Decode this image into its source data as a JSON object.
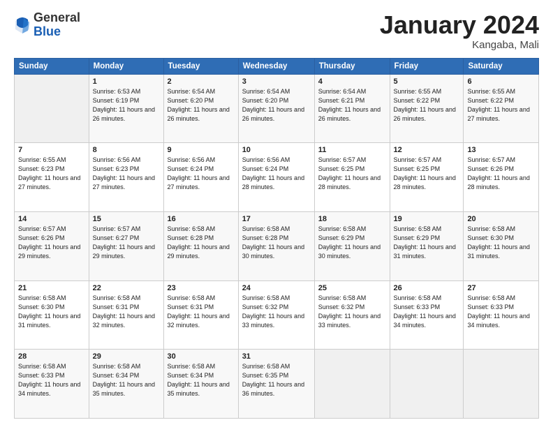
{
  "header": {
    "logo_general": "General",
    "logo_blue": "Blue",
    "month_title": "January 2024",
    "location": "Kangaba, Mali"
  },
  "days_of_week": [
    "Sunday",
    "Monday",
    "Tuesday",
    "Wednesday",
    "Thursday",
    "Friday",
    "Saturday"
  ],
  "weeks": [
    [
      {
        "day": "",
        "sunrise": "",
        "sunset": "",
        "daylight": ""
      },
      {
        "day": "1",
        "sunrise": "Sunrise: 6:53 AM",
        "sunset": "Sunset: 6:19 PM",
        "daylight": "Daylight: 11 hours and 26 minutes."
      },
      {
        "day": "2",
        "sunrise": "Sunrise: 6:54 AM",
        "sunset": "Sunset: 6:20 PM",
        "daylight": "Daylight: 11 hours and 26 minutes."
      },
      {
        "day": "3",
        "sunrise": "Sunrise: 6:54 AM",
        "sunset": "Sunset: 6:20 PM",
        "daylight": "Daylight: 11 hours and 26 minutes."
      },
      {
        "day": "4",
        "sunrise": "Sunrise: 6:54 AM",
        "sunset": "Sunset: 6:21 PM",
        "daylight": "Daylight: 11 hours and 26 minutes."
      },
      {
        "day": "5",
        "sunrise": "Sunrise: 6:55 AM",
        "sunset": "Sunset: 6:22 PM",
        "daylight": "Daylight: 11 hours and 26 minutes."
      },
      {
        "day": "6",
        "sunrise": "Sunrise: 6:55 AM",
        "sunset": "Sunset: 6:22 PM",
        "daylight": "Daylight: 11 hours and 27 minutes."
      }
    ],
    [
      {
        "day": "7",
        "sunrise": "Sunrise: 6:55 AM",
        "sunset": "Sunset: 6:23 PM",
        "daylight": "Daylight: 11 hours and 27 minutes."
      },
      {
        "day": "8",
        "sunrise": "Sunrise: 6:56 AM",
        "sunset": "Sunset: 6:23 PM",
        "daylight": "Daylight: 11 hours and 27 minutes."
      },
      {
        "day": "9",
        "sunrise": "Sunrise: 6:56 AM",
        "sunset": "Sunset: 6:24 PM",
        "daylight": "Daylight: 11 hours and 27 minutes."
      },
      {
        "day": "10",
        "sunrise": "Sunrise: 6:56 AM",
        "sunset": "Sunset: 6:24 PM",
        "daylight": "Daylight: 11 hours and 28 minutes."
      },
      {
        "day": "11",
        "sunrise": "Sunrise: 6:57 AM",
        "sunset": "Sunset: 6:25 PM",
        "daylight": "Daylight: 11 hours and 28 minutes."
      },
      {
        "day": "12",
        "sunrise": "Sunrise: 6:57 AM",
        "sunset": "Sunset: 6:25 PM",
        "daylight": "Daylight: 11 hours and 28 minutes."
      },
      {
        "day": "13",
        "sunrise": "Sunrise: 6:57 AM",
        "sunset": "Sunset: 6:26 PM",
        "daylight": "Daylight: 11 hours and 28 minutes."
      }
    ],
    [
      {
        "day": "14",
        "sunrise": "Sunrise: 6:57 AM",
        "sunset": "Sunset: 6:26 PM",
        "daylight": "Daylight: 11 hours and 29 minutes."
      },
      {
        "day": "15",
        "sunrise": "Sunrise: 6:57 AM",
        "sunset": "Sunset: 6:27 PM",
        "daylight": "Daylight: 11 hours and 29 minutes."
      },
      {
        "day": "16",
        "sunrise": "Sunrise: 6:58 AM",
        "sunset": "Sunset: 6:28 PM",
        "daylight": "Daylight: 11 hours and 29 minutes."
      },
      {
        "day": "17",
        "sunrise": "Sunrise: 6:58 AM",
        "sunset": "Sunset: 6:28 PM",
        "daylight": "Daylight: 11 hours and 30 minutes."
      },
      {
        "day": "18",
        "sunrise": "Sunrise: 6:58 AM",
        "sunset": "Sunset: 6:29 PM",
        "daylight": "Daylight: 11 hours and 30 minutes."
      },
      {
        "day": "19",
        "sunrise": "Sunrise: 6:58 AM",
        "sunset": "Sunset: 6:29 PM",
        "daylight": "Daylight: 11 hours and 31 minutes."
      },
      {
        "day": "20",
        "sunrise": "Sunrise: 6:58 AM",
        "sunset": "Sunset: 6:30 PM",
        "daylight": "Daylight: 11 hours and 31 minutes."
      }
    ],
    [
      {
        "day": "21",
        "sunrise": "Sunrise: 6:58 AM",
        "sunset": "Sunset: 6:30 PM",
        "daylight": "Daylight: 11 hours and 31 minutes."
      },
      {
        "day": "22",
        "sunrise": "Sunrise: 6:58 AM",
        "sunset": "Sunset: 6:31 PM",
        "daylight": "Daylight: 11 hours and 32 minutes."
      },
      {
        "day": "23",
        "sunrise": "Sunrise: 6:58 AM",
        "sunset": "Sunset: 6:31 PM",
        "daylight": "Daylight: 11 hours and 32 minutes."
      },
      {
        "day": "24",
        "sunrise": "Sunrise: 6:58 AM",
        "sunset": "Sunset: 6:32 PM",
        "daylight": "Daylight: 11 hours and 33 minutes."
      },
      {
        "day": "25",
        "sunrise": "Sunrise: 6:58 AM",
        "sunset": "Sunset: 6:32 PM",
        "daylight": "Daylight: 11 hours and 33 minutes."
      },
      {
        "day": "26",
        "sunrise": "Sunrise: 6:58 AM",
        "sunset": "Sunset: 6:33 PM",
        "daylight": "Daylight: 11 hours and 34 minutes."
      },
      {
        "day": "27",
        "sunrise": "Sunrise: 6:58 AM",
        "sunset": "Sunset: 6:33 PM",
        "daylight": "Daylight: 11 hours and 34 minutes."
      }
    ],
    [
      {
        "day": "28",
        "sunrise": "Sunrise: 6:58 AM",
        "sunset": "Sunset: 6:33 PM",
        "daylight": "Daylight: 11 hours and 34 minutes."
      },
      {
        "day": "29",
        "sunrise": "Sunrise: 6:58 AM",
        "sunset": "Sunset: 6:34 PM",
        "daylight": "Daylight: 11 hours and 35 minutes."
      },
      {
        "day": "30",
        "sunrise": "Sunrise: 6:58 AM",
        "sunset": "Sunset: 6:34 PM",
        "daylight": "Daylight: 11 hours and 35 minutes."
      },
      {
        "day": "31",
        "sunrise": "Sunrise: 6:58 AM",
        "sunset": "Sunset: 6:35 PM",
        "daylight": "Daylight: 11 hours and 36 minutes."
      },
      {
        "day": "",
        "sunrise": "",
        "sunset": "",
        "daylight": ""
      },
      {
        "day": "",
        "sunrise": "",
        "sunset": "",
        "daylight": ""
      },
      {
        "day": "",
        "sunrise": "",
        "sunset": "",
        "daylight": ""
      }
    ]
  ]
}
